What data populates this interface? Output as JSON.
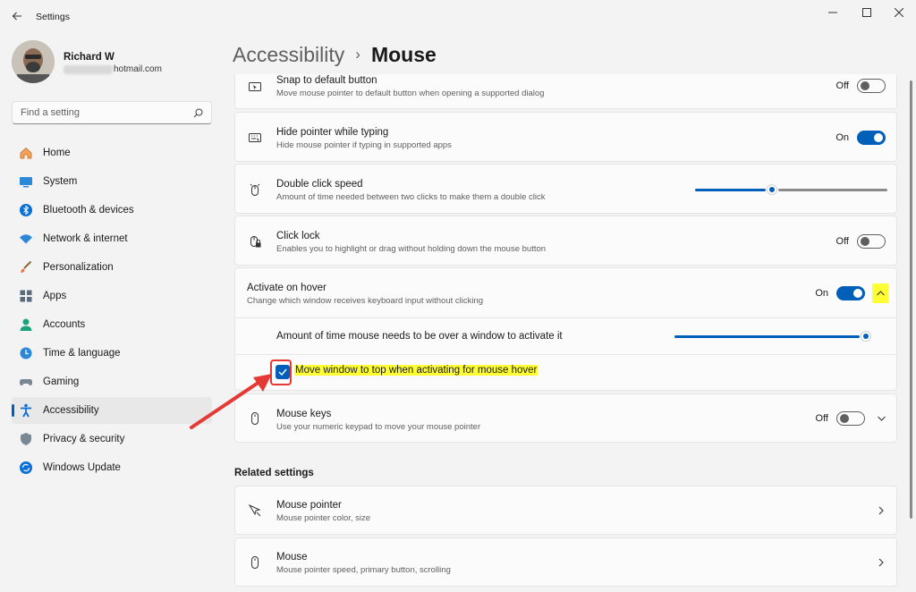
{
  "window": {
    "title": "Settings"
  },
  "user": {
    "name": "Richard W",
    "email": "hotmail.com"
  },
  "search": {
    "placeholder": "Find a setting"
  },
  "nav": [
    {
      "label": "Home",
      "icon": "home-icon"
    },
    {
      "label": "System",
      "icon": "system-icon"
    },
    {
      "label": "Bluetooth & devices",
      "icon": "bluetooth-icon"
    },
    {
      "label": "Network & internet",
      "icon": "wifi-icon"
    },
    {
      "label": "Personalization",
      "icon": "brush-icon"
    },
    {
      "label": "Apps",
      "icon": "apps-icon"
    },
    {
      "label": "Accounts",
      "icon": "account-icon"
    },
    {
      "label": "Time & language",
      "icon": "clock-icon"
    },
    {
      "label": "Gaming",
      "icon": "gamepad-icon"
    },
    {
      "label": "Accessibility",
      "icon": "accessibility-icon",
      "active": true
    },
    {
      "label": "Privacy & security",
      "icon": "shield-icon"
    },
    {
      "label": "Windows Update",
      "icon": "update-icon"
    }
  ],
  "breadcrumb": {
    "parent": "Accessibility",
    "separator": "›",
    "current": "Mouse"
  },
  "settings": {
    "snap": {
      "title": "Snap to default button",
      "desc": "Move mouse pointer to default button when opening a supported dialog",
      "state": "Off"
    },
    "hide": {
      "title": "Hide pointer while typing",
      "desc": "Hide mouse pointer if typing in supported apps",
      "state": "On"
    },
    "dbl": {
      "title": "Double click speed",
      "desc": "Amount of time needed between two clicks to make them a double click",
      "slider_fraction": 0.4
    },
    "clicklock": {
      "title": "Click lock",
      "desc": "Enables you to highlight or drag without holding down the mouse button",
      "state": "Off"
    },
    "hover": {
      "title": "Activate on hover",
      "desc": "Change which window receives keyboard input without clicking",
      "state": "On",
      "time_label": "Amount of time mouse needs to be over a window to activate it",
      "time_slider_fraction": 1.0,
      "checkbox_label": "Move window to top when activating for mouse hover",
      "checkbox_checked": true
    },
    "mousekeys": {
      "title": "Mouse keys",
      "desc": "Use your numeric keypad to move your mouse pointer",
      "state": "Off"
    }
  },
  "related": {
    "heading": "Related settings",
    "items": [
      {
        "title": "Mouse pointer",
        "desc": "Mouse pointer color, size"
      },
      {
        "title": "Mouse",
        "desc": "Mouse pointer speed, primary button, scrolling"
      }
    ]
  },
  "colors": {
    "accent": "#005fb8",
    "highlight": "#ffff33",
    "annotation": "#e53935"
  }
}
